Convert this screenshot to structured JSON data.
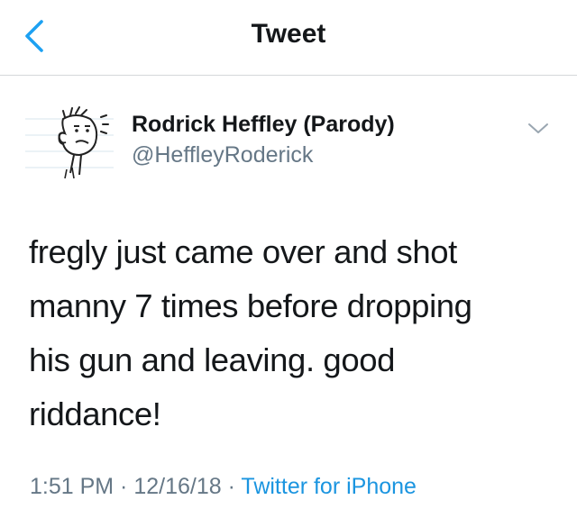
{
  "nav": {
    "title": "Tweet",
    "back_icon": "chevron-left-icon",
    "accent_color": "#1da1f2"
  },
  "tweet": {
    "author_name": "Rodrick Heffley (Parody)",
    "author_handle": "@HeffleyRoderick",
    "menu_icon": "chevron-down-icon",
    "text_lines": [
      "fregly just came over and shot",
      "manny 7 times before dropping",
      "his gun and leaving. good",
      "riddance!"
    ],
    "time": "1:51 PM",
    "separator_1": " · ",
    "date": "12/16/18",
    "separator_2": " · ",
    "source": "Twitter for iPhone",
    "source_color": "#1b95e0"
  }
}
